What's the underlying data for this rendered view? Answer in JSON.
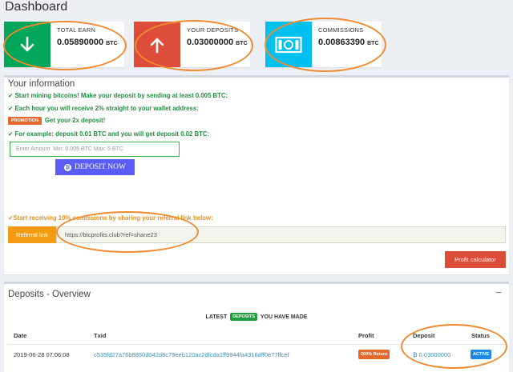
{
  "page": {
    "title": "Dashboard"
  },
  "stats": [
    {
      "label": "TOTAL EARN",
      "value": "0.05890000",
      "unit": "BTC",
      "icon": "arrow-down-icon",
      "color": "#00a65a"
    },
    {
      "label": "YOUR DEPOSITS",
      "value": "0.03000000",
      "unit": "BTC",
      "icon": "arrow-up-icon",
      "color": "#dd4b39"
    },
    {
      "label": "COMMISSIONS",
      "value": "0.00863390",
      "unit": "BTC",
      "icon": "money-bill-icon",
      "color": "#00c0ef"
    }
  ],
  "info": {
    "title": "Your information",
    "lines": [
      "Start mining bitcoins! Make your deposit by sending at least 0.005 BTC:",
      "Each hour you will receive 2% straight to your wallet address:",
      "Get your 2x deposit!",
      "For example: deposit 0.01 BTC and you will get deposit 0.02 BTC:"
    ],
    "promotion_badge": "PROMOTION",
    "amount_placeholder": "Enter Amount  Min: 0.005 BTC Max: 5 BTC",
    "deposit_button": "DEPOSIT NOW",
    "referral_text": "Start receiving 10% comissions by sharing your referral link below:",
    "referral_label": "Referral link",
    "referral_link": "https://btcprofits.club?ref=shane23",
    "calc_button": "Profit calculator"
  },
  "deposits": {
    "title": "Deposits - Overview",
    "collapse": "−",
    "latest_prefix": "LATEST",
    "latest_badge": "DEPOSITS",
    "latest_suffix": "YOU HAVE MADE",
    "headers": {
      "date": "Date",
      "txid": "Txid",
      "profit": "Profit",
      "deposit": "Deposit",
      "status": "Status"
    },
    "rows": [
      {
        "date": "2019-06-28 07:06:08",
        "txid": "c535fd27a76b8850d042d8c79eeb120ac2dfcda1ff9944fa4316dff0e77ffcef",
        "profit": "200% Return",
        "deposit": "0.03000000",
        "status": "ACTIVE"
      }
    ]
  },
  "colors": {
    "accent_orange": "#f08a2e",
    "success": "#1f8f3b",
    "primary": "#5a5cf5"
  }
}
